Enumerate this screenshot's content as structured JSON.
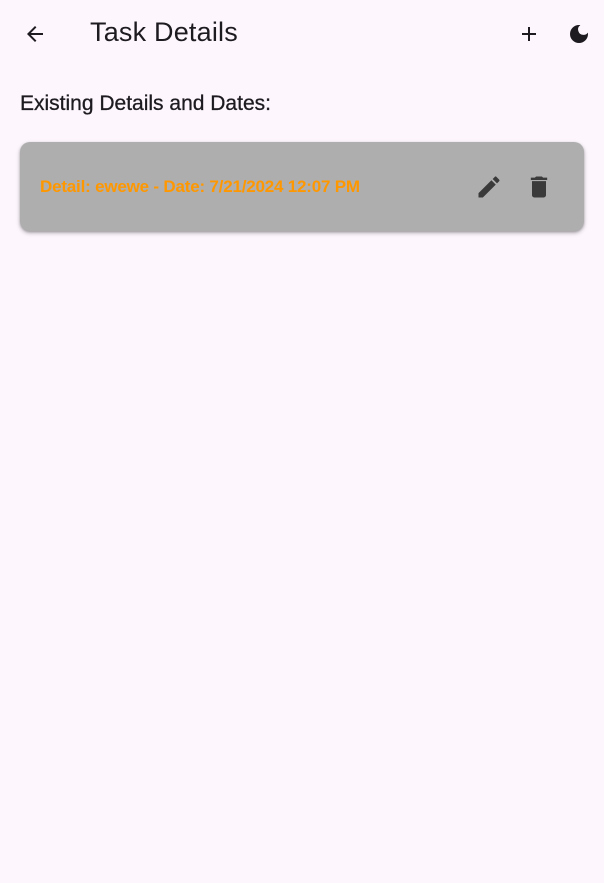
{
  "appbar": {
    "title": "Task Details",
    "back_icon": "arrow-back-icon",
    "add_icon": "plus-icon",
    "theme_icon": "moon-icon"
  },
  "section": {
    "heading": "Existing Details and Dates:"
  },
  "details": [
    {
      "text": "Detail: ewewe - Date: 7/21/2024 12:07 PM",
      "edit_icon": "pencil-icon",
      "delete_icon": "trash-icon"
    }
  ],
  "colors": {
    "background": "#fdf7fd",
    "card": "#aeaeae",
    "detail_text": "#ff9800",
    "icon": "#1d1b20",
    "card_icon": "#3a3a3a"
  }
}
